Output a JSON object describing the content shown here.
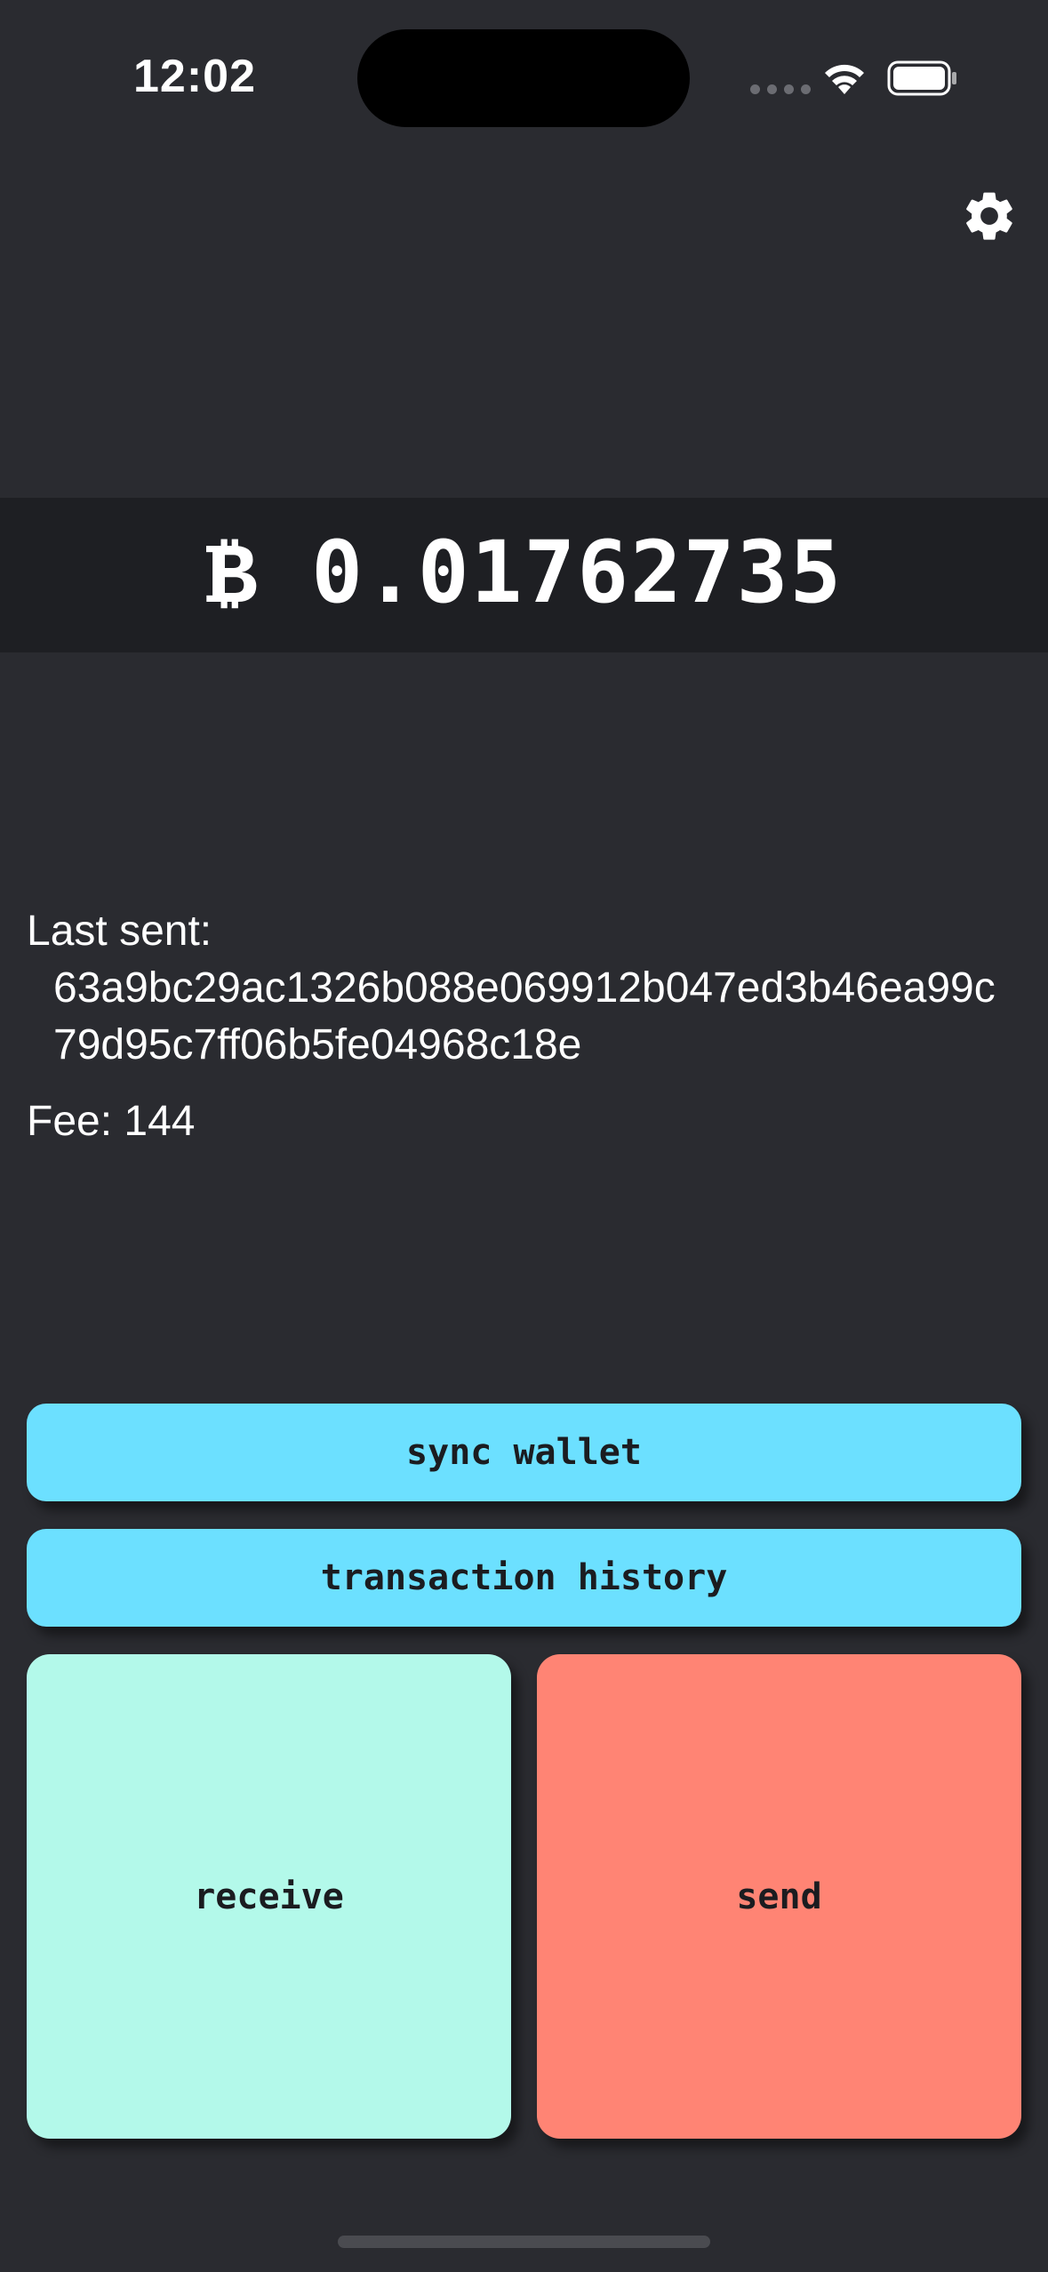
{
  "status_bar": {
    "time": "12:02",
    "icons": [
      "signal-icon",
      "wifi-icon",
      "battery-icon"
    ]
  },
  "header": {
    "settings_icon": "gear-icon"
  },
  "balance": {
    "text": "₿ 0.01762735"
  },
  "last_tx": {
    "label": "Last sent:",
    "txid": "63a9bc29ac1326b088e069912b047ed3b46ea99c79d95c7ff06b5fe04968c18e",
    "fee": "Fee: 144"
  },
  "actions": {
    "sync_label": "sync wallet",
    "history_label": "transaction history",
    "receive_label": "receive",
    "send_label": "send"
  },
  "colors": {
    "background": "#2a2b30",
    "balance_bar": "#1e1f23",
    "primary_button": "#6ce0ff",
    "receive_button": "#b3f9ea",
    "send_button": "#ff8474"
  }
}
